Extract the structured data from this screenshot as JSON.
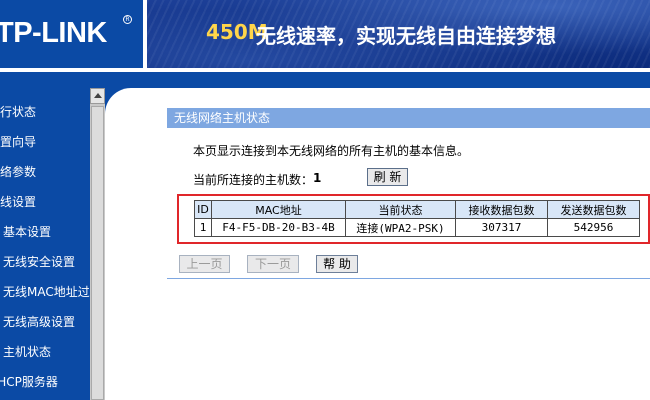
{
  "header": {
    "logo": "TP-LINK",
    "logo_mark": "R",
    "banner_speed": "450M",
    "banner_slogan": "无线速率，实现无线自由连接梦想"
  },
  "sidebar": {
    "items": [
      {
        "label": "运行状态"
      },
      {
        "label": "设置向导"
      },
      {
        "label": "网络参数"
      },
      {
        "label": "无线设置"
      },
      {
        "label": "基本设置"
      },
      {
        "label": "无线安全设置"
      },
      {
        "label": "无线MAC地址过滤"
      },
      {
        "label": "无线高级设置"
      },
      {
        "label": "主机状态"
      },
      {
        "label": "DHCP服务器"
      }
    ]
  },
  "panel": {
    "title": "无线网络主机状态",
    "description": "本页显示连接到本无线网络的所有主机的基本信息。",
    "count_label": "当前所连接的主机数：",
    "count_value": "1",
    "refresh_label": "刷 新"
  },
  "table": {
    "headers": [
      "ID",
      "MAC地址",
      "当前状态",
      "接收数据包数",
      "发送数据包数"
    ],
    "rows": [
      [
        "1",
        "F4-F5-DB-20-B3-4B",
        "连接(WPA2-PSK)",
        "307317",
        "542956"
      ]
    ]
  },
  "buttons": {
    "prev": "上一页",
    "next": "下一页",
    "help": "帮 助"
  },
  "colors": {
    "brand_blue": "#0b4aa5",
    "panel_title_bg": "#7ea7e1",
    "table_header_bg": "#d8e6f7",
    "highlight": "#e0262a",
    "banner_accent": "#ffd54a"
  }
}
